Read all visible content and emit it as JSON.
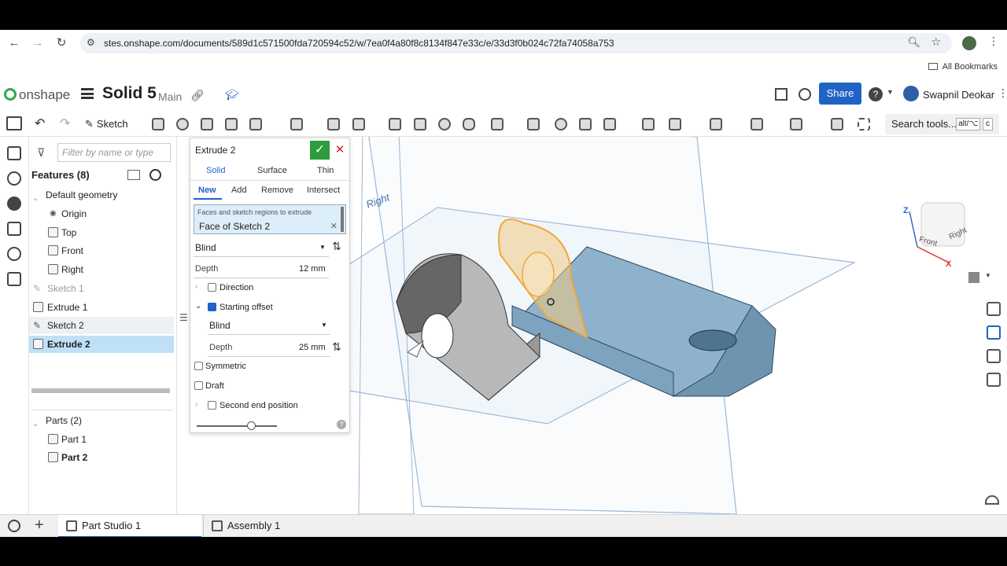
{
  "browser": {
    "url": "stes.onshape.com/documents/589d1c571500fda720594c52/w/7ea0f4a80f8c8134f847e33c/e/33d3f0b024c72fa74058a753",
    "bookmarks_label": "All Bookmarks"
  },
  "app": {
    "logo_text": "onshape",
    "doc_title": "Solid 5",
    "branch": "Main",
    "share_label": "Share",
    "user_name": "Swapnil Deokar"
  },
  "toolbar": {
    "sketch_label": "Sketch",
    "search_label": "Search tools...",
    "search_kbd": "alt/⌥",
    "search_kbd2": "c"
  },
  "features": {
    "filter_placeholder": "Filter by name or type",
    "header": "Features (8)",
    "items": [
      {
        "label": "Default geometry"
      },
      {
        "label": "Origin"
      },
      {
        "label": "Top"
      },
      {
        "label": "Front"
      },
      {
        "label": "Right"
      },
      {
        "label": "Sketch 1"
      },
      {
        "label": "Extrude 1"
      },
      {
        "label": "Sketch 2"
      },
      {
        "label": "Extrude 2"
      }
    ],
    "parts_header": "Parts (2)",
    "parts": [
      {
        "label": "Part 1"
      },
      {
        "label": "Part 2"
      }
    ]
  },
  "extrude": {
    "title": "Extrude 2",
    "body_tabs": [
      "Solid",
      "Surface",
      "Thin"
    ],
    "op_tabs": [
      "New",
      "Add",
      "Remove",
      "Intersect"
    ],
    "selection_hint": "Faces and sketch regions to extrude",
    "selection_value": "Face of Sketch 2",
    "end_type": "Blind",
    "depth_label": "Depth",
    "depth_value": "12 mm",
    "direction_label": "Direction",
    "starting_offset_label": "Starting offset",
    "offset_type": "Blind",
    "offset_depth_label": "Depth",
    "offset_depth_value": "25 mm",
    "symmetric_label": "Symmetric",
    "draft_label": "Draft",
    "second_end_label": "Second end position"
  },
  "viewport": {
    "plane_label": "Right",
    "cube_front": "Front",
    "cube_right": "Right",
    "axis_z": "Z",
    "axis_x": "X"
  },
  "tabs": [
    {
      "label": "Part Studio 1"
    },
    {
      "label": "Assembly 1"
    }
  ],
  "colors": {
    "accent": "#1f63c5",
    "confirm": "#2e9b3e",
    "cancel": "#c8232c",
    "part_fill": "#8fb2cc",
    "highlight": "#f0a83a"
  }
}
